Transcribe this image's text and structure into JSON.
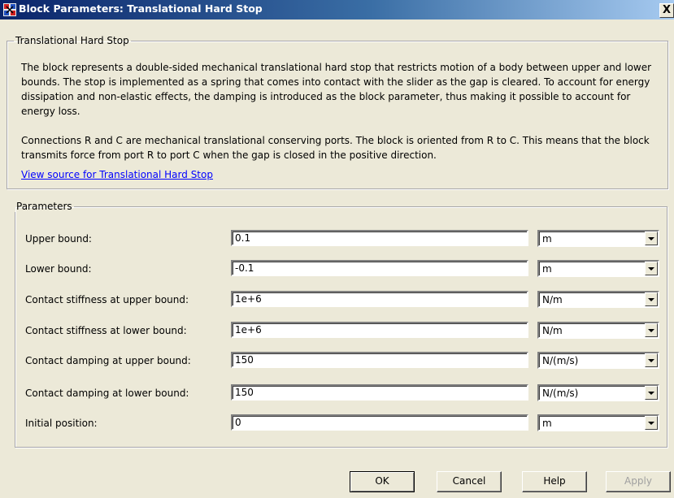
{
  "window": {
    "title": "Block Parameters: Translational Hard Stop",
    "close_glyph": "X",
    "icon": "simulink-block-icon"
  },
  "description": {
    "group_label": "Translational Hard Stop",
    "paragraph1": "The block represents a double-sided mechanical translational hard stop that restricts motion of a body between upper and lower bounds. The stop is implemented as a spring that comes into contact with the slider as the gap is cleared. To account for energy dissipation and non-elastic effects, the damping is introduced as the block parameter, thus making it possible to account for energy loss.",
    "paragraph2": "Connections R and C are mechanical translational conserving ports. The block is oriented from R to C. This means that the block transmits force from port R to port C when the gap is closed in the positive direction.",
    "link": "View source for Translational Hard Stop"
  },
  "parameters": {
    "group_label": "Parameters",
    "rows": [
      {
        "label": "Upper bound:",
        "value": "0.1",
        "unit": "m"
      },
      {
        "label": "Lower bound:",
        "value": "-0.1",
        "unit": "m"
      },
      {
        "label": "Contact stiffness at upper bound:",
        "value": "1e+6",
        "unit": "N/m"
      },
      {
        "label": "Contact stiffness at lower bound:",
        "value": "1e+6",
        "unit": "N/m"
      },
      {
        "label": "Contact damping at upper bound:",
        "value": "150",
        "unit": "N/(m/s)"
      },
      {
        "label": "Contact damping at lower bound:",
        "value": "150",
        "unit": "N/(m/s)"
      },
      {
        "label": "Initial position:",
        "value": "0",
        "unit": "m"
      }
    ]
  },
  "buttons": {
    "ok": "OK",
    "cancel": "Cancel",
    "help": "Help",
    "apply": "Apply"
  }
}
